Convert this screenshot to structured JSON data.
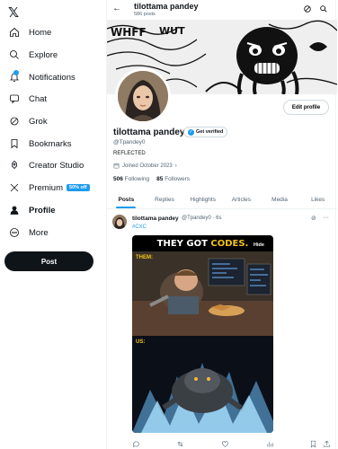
{
  "nav": {
    "items": [
      {
        "label": "Home",
        "icon": "home-icon"
      },
      {
        "label": "Explore",
        "icon": "search-icon"
      },
      {
        "label": "Notifications",
        "icon": "bell-icon"
      },
      {
        "label": "Chat",
        "icon": "chat-icon"
      },
      {
        "label": "Grok",
        "icon": "grok-icon"
      },
      {
        "label": "Bookmarks",
        "icon": "bookmark-icon"
      },
      {
        "label": "Creator Studio",
        "icon": "rocket-icon"
      },
      {
        "label": "Premium",
        "icon": "x-icon"
      },
      {
        "label": "Profile",
        "icon": "person-icon"
      },
      {
        "label": "More",
        "icon": "more-circle-icon"
      }
    ],
    "premium_badge": "50% off",
    "post_label": "Post"
  },
  "header": {
    "name": "tilottama pandey",
    "post_count": "586 posts"
  },
  "profile": {
    "name": "tilottama pandey",
    "verify_label": "Get verified",
    "handle": "@Tpandey0",
    "bio": "REFLECTED",
    "joined": "Joined October 2023",
    "following_count": "506",
    "following_label": "Following",
    "followers_count": "85",
    "followers_label": "Followers",
    "edit_label": "Edit profile"
  },
  "tabs": [
    "Posts",
    "Replies",
    "Highlights",
    "Articles",
    "Media",
    "Likes"
  ],
  "tweet": {
    "name": "tilottama pandey",
    "meta": "@Tpandey0 · 6s",
    "hashtag": "#CXC",
    "media_title_a": "THEY GOT ",
    "media_title_b": "CODES.",
    "hide_label": "Hide",
    "label_them": "THEM:",
    "label_us": "US:"
  },
  "colors": {
    "accent": "#1d9bf0",
    "text": "#0f1419",
    "muted": "#536471",
    "gold": "#f3c31b"
  }
}
